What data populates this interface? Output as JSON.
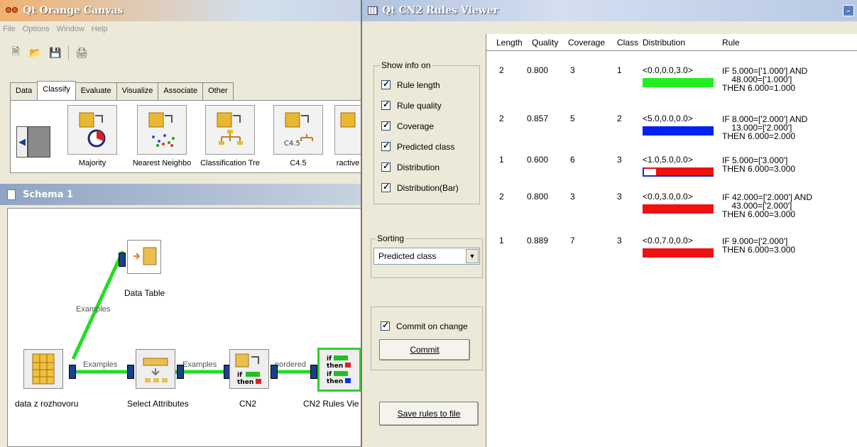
{
  "canvas": {
    "title": "Qt Orange Canvas",
    "menu": [
      "File",
      "Options",
      "Window",
      "Help"
    ],
    "tabs": [
      "Data",
      "Classify",
      "Evaluate",
      "Visualize",
      "Associate",
      "Other"
    ],
    "active_tab": "Classify",
    "shelf_items": [
      "Majority",
      "Nearest Neighbo",
      "Classification Tre",
      "C4.5",
      "ractive"
    ],
    "c45_icon_text": "C4.5",
    "schema_title": "Schema 1",
    "nodes": {
      "data": "data z rozhovoru",
      "select": "Select Attributes",
      "cn2": "CN2",
      "viewer": "CN2 Rules Vie",
      "table": "Data Table"
    },
    "link_labels": {
      "data_to_table": "Examples",
      "data_to_select": "Examples",
      "select_to_cn2": "Examples",
      "cn2_to_viewer": "nordered"
    },
    "icon_text": {
      "if": "if",
      "then": "then"
    }
  },
  "viewer": {
    "title": "Qt CN2 Rules Viewer",
    "show_info_title": "Show info on",
    "options": [
      "Rule length",
      "Rule quality",
      "Coverage",
      "Predicted class",
      "Distribution",
      "Distribution(Bar)"
    ],
    "sorting_title": "Sorting",
    "sorting_value": "Predicted class",
    "commit_on_change": "Commit on change",
    "commit_button": "Commit",
    "save_button": "Save rules to file",
    "columns": [
      "Length",
      "Quality",
      "Coverage",
      "Class",
      "Distribution",
      "Rule"
    ],
    "rules": [
      {
        "length": "2",
        "quality": "0.800",
        "coverage": "3",
        "class": "1",
        "distribution": "<0.0,0.0,3.0>",
        "bar_color": "#22ee22",
        "bar_empty_fraction": 0,
        "rule": "IF 5.000=['1.000'] AND\n    48.000=['1.000']\nTHEN 6.000=1.000"
      },
      {
        "length": "2",
        "quality": "0.857",
        "coverage": "5",
        "class": "2",
        "distribution": "<5.0,0.0,0.0>",
        "bar_color": "#0022ee",
        "bar_empty_fraction": 0,
        "rule": "IF 8.000=['2.000'] AND\n    13.000=['2.000']\nTHEN 6.000=2.000"
      },
      {
        "length": "1",
        "quality": "0.600",
        "coverage": "6",
        "class": "3",
        "distribution": "<1.0,5.0,0.0>",
        "bar_color": "#ee1111",
        "bar_empty_fraction": 0.167,
        "rule": "IF 5.000=['3.000']\nTHEN 6.000=3.000"
      },
      {
        "length": "2",
        "quality": "0.800",
        "coverage": "3",
        "class": "3",
        "distribution": "<0.0,3.0,0.0>",
        "bar_color": "#ee1111",
        "bar_empty_fraction": 0,
        "rule": "IF 42.000=['2.000'] AND\n    43.000=['2.000']\nTHEN 6.000=3.000"
      },
      {
        "length": "1",
        "quality": "0.889",
        "coverage": "7",
        "class": "3",
        "distribution": "<0.0,7.0,0.0>",
        "bar_color": "#ee1111",
        "bar_empty_fraction": 0,
        "rule": "IF 9.000=['2.000']\nTHEN 6.000=3.000"
      }
    ]
  }
}
